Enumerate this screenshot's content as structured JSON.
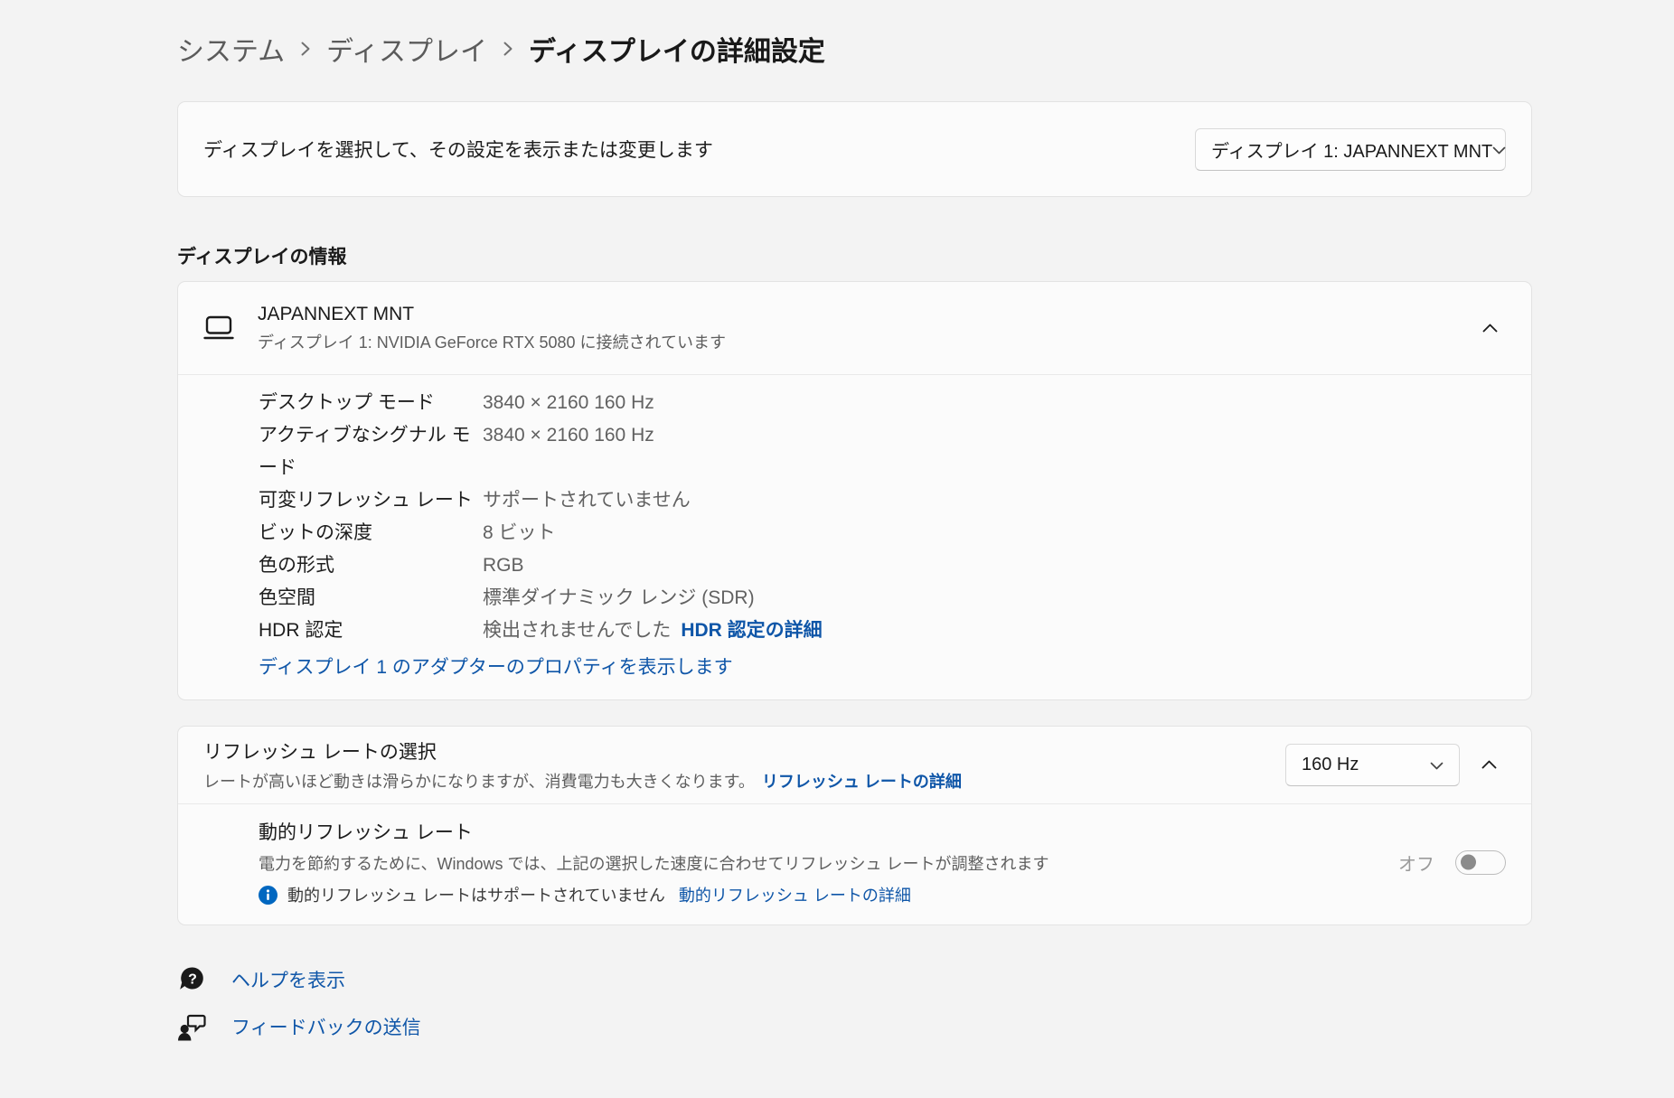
{
  "colors": {
    "page_background": "#f3f3f3",
    "card_background": "#fbfbfb",
    "link_blue": "#0f56a8",
    "info_icon_blue": "#0067c0"
  },
  "breadcrumb": {
    "items": [
      "システム",
      "ディスプレイ"
    ],
    "current": "ディスプレイの詳細設定"
  },
  "display_selector": {
    "description": "ディスプレイを選択して、その設定を表示または変更します",
    "dropdown_value": "ディスプレイ 1: JAPANNEXT MNT"
  },
  "display_info": {
    "section_title": "ディスプレイの情報",
    "device_name": "JAPANNEXT MNT",
    "connection": "ディスプレイ 1: NVIDIA GeForce RTX 5080 に接続されています",
    "rows": [
      {
        "label": "デスクトップ モード",
        "value": "3840 × 2160 160 Hz"
      },
      {
        "label": "アクティブなシグナル モード",
        "value": "3840 × 2160 160 Hz"
      },
      {
        "label": "可変リフレッシュ レート",
        "value": "サポートされていません"
      },
      {
        "label": "ビットの深度",
        "value": "8 ビット"
      },
      {
        "label": "色の形式",
        "value": "RGB"
      },
      {
        "label": "色空間",
        "value": "標準ダイナミック レンジ (SDR)"
      },
      {
        "label": "HDR 認定",
        "value": "検出されませんでした",
        "link": "HDR 認定の詳細"
      }
    ],
    "adapter_link": "ディスプレイ 1 のアダプターのプロパティを表示します"
  },
  "refresh_rate": {
    "title": "リフレッシュ レートの選択",
    "description": "レートが高いほど動きは滑らかになりますが、消費電力も大きくなります。",
    "link": "リフレッシュ レートの詳細",
    "dropdown_value": "160 Hz",
    "dynamic": {
      "title": "動的リフレッシュ レート",
      "description": "電力を節約するために、Windows では、上記の選択した速度に合わせてリフレッシュ レートが調整されます",
      "status": "動的リフレッシュ レートはサポートされていません",
      "status_link": "動的リフレッシュ レートの詳細",
      "toggle_label": "オフ",
      "toggle_state": "off"
    }
  },
  "footer_links": [
    {
      "label": "ヘルプを表示"
    },
    {
      "label": "フィードバックの送信"
    }
  ]
}
